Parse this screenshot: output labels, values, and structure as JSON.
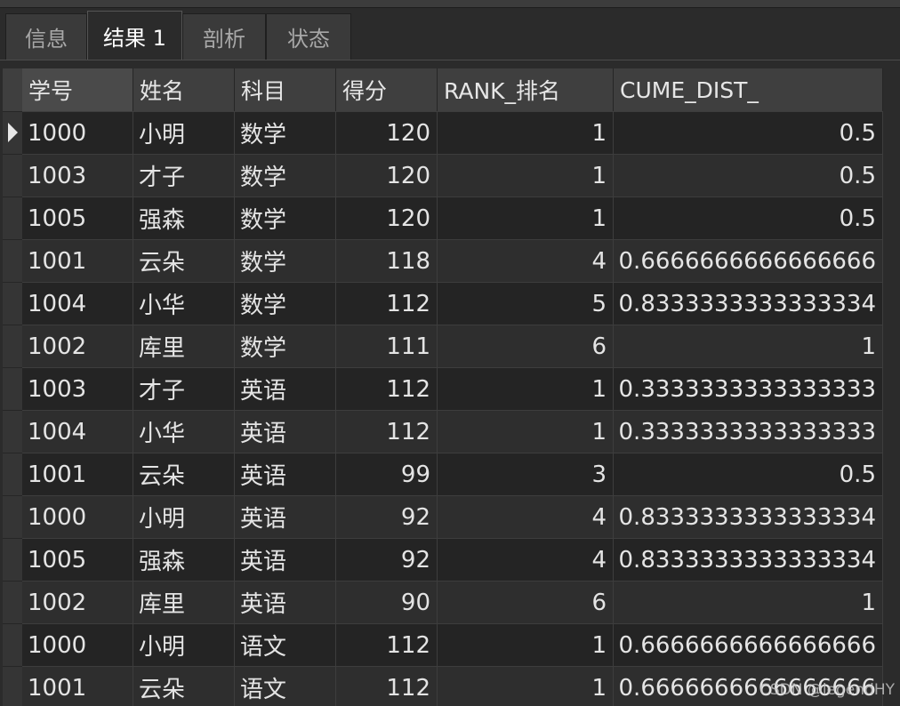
{
  "tabs": [
    {
      "label": "信息",
      "active": false
    },
    {
      "label": "结果 1",
      "active": true
    },
    {
      "label": "剖析",
      "active": false
    },
    {
      "label": "状态",
      "active": false
    }
  ],
  "columns": [
    "学号",
    "姓名",
    "科目",
    "得分",
    "RANK_排名",
    "CUME_DIST_"
  ],
  "rows": [
    [
      "1000",
      "小明",
      "数学",
      "120",
      "1",
      "0.5"
    ],
    [
      "1003",
      "才子",
      "数学",
      "120",
      "1",
      "0.5"
    ],
    [
      "1005",
      "强森",
      "数学",
      "120",
      "1",
      "0.5"
    ],
    [
      "1001",
      "云朵",
      "数学",
      "118",
      "4",
      "0.6666666666666666"
    ],
    [
      "1004",
      "小华",
      "数学",
      "112",
      "5",
      "0.8333333333333334"
    ],
    [
      "1002",
      "库里",
      "数学",
      "111",
      "6",
      "1"
    ],
    [
      "1003",
      "才子",
      "英语",
      "112",
      "1",
      "0.3333333333333333"
    ],
    [
      "1004",
      "小华",
      "英语",
      "112",
      "1",
      "0.3333333333333333"
    ],
    [
      "1001",
      "云朵",
      "英语",
      "99",
      "3",
      "0.5"
    ],
    [
      "1000",
      "小明",
      "英语",
      "92",
      "4",
      "0.8333333333333334"
    ],
    [
      "1005",
      "强森",
      "英语",
      "92",
      "4",
      "0.8333333333333334"
    ],
    [
      "1002",
      "库里",
      "英语",
      "90",
      "6",
      "1"
    ],
    [
      "1000",
      "小明",
      "语文",
      "112",
      "1",
      "0.6666666666666666"
    ],
    [
      "1001",
      "云朵",
      "语文",
      "112",
      "1",
      "0.6666666666666666"
    ]
  ],
  "selected_row": 0,
  "watermark": "CSDN @legendHY",
  "colors": {
    "background": "#2b2b2b",
    "header_bg": "#3f3f3f",
    "active_tab_text": "#ffffff",
    "cell_text": "#e4e4e4"
  }
}
